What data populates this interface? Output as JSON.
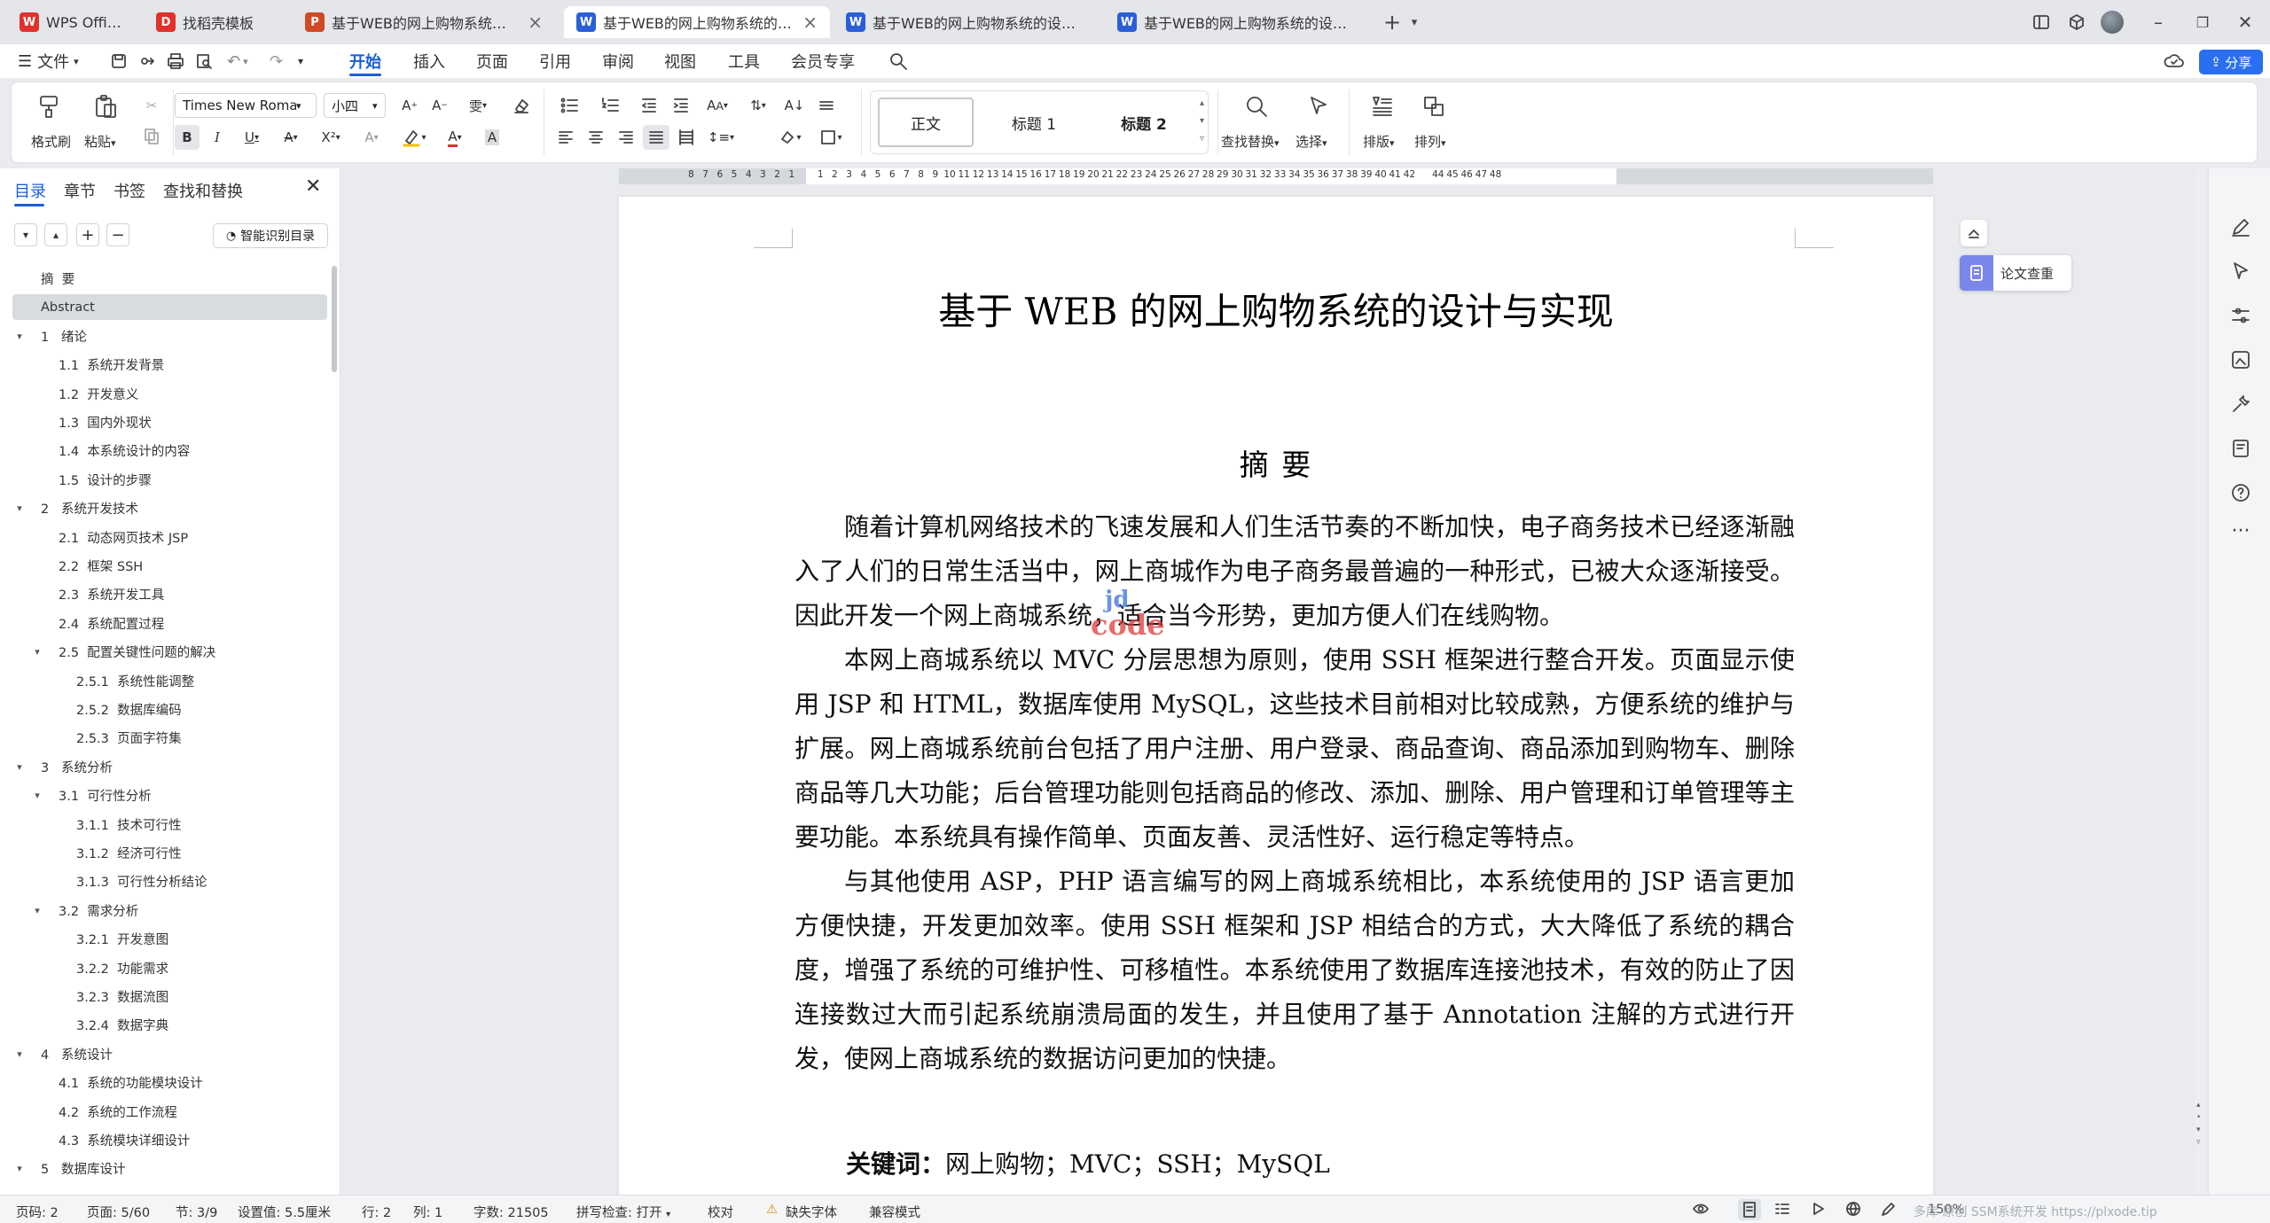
{
  "tabs": [
    {
      "label": "WPS Office",
      "letter": "W",
      "color": "#e0322b"
    },
    {
      "label": "找稻壳模板",
      "letter": "D",
      "color": "#e0322b"
    },
    {
      "label": "基于WEB的网上购物系统的设计与实",
      "letter": "P",
      "color": "#d04a23"
    },
    {
      "label": "基于WEB的网上购物系统的设计与实",
      "letter": "W",
      "color": "#2b5fd8"
    },
    {
      "label": "基于WEB的网上购物系统的设计与实现",
      "letter": "W",
      "color": "#2b5fd8"
    },
    {
      "label": "基于WEB的网上购物系统的设计与实",
      "letter": "W",
      "color": "#2b5fd8"
    }
  ],
  "menu": {
    "file": "文件",
    "items": [
      "开始",
      "插入",
      "页面",
      "引用",
      "审阅",
      "视图",
      "工具",
      "会员专享"
    ],
    "share": "分享"
  },
  "ribbon": {
    "format_painter": "格式刷",
    "paste": "粘贴",
    "font_name": "Times New Roman",
    "font_size": "小四",
    "styles": [
      "正文",
      "标题 1",
      "标题 2"
    ],
    "find_replace": "查找替换",
    "select": "选择",
    "layout": "排版",
    "arrange": "排列"
  },
  "nav": {
    "tabs": [
      "目录",
      "章节",
      "书签",
      "查找和替换"
    ],
    "smart_toc": "智能识别目录",
    "toc": [
      {
        "label": "摘  要",
        "level": 1,
        "toggle": false,
        "sel": false
      },
      {
        "label": "Abstract",
        "level": 1,
        "toggle": false,
        "sel": true
      },
      {
        "label": "1   绪论",
        "level": 1,
        "toggle": true
      },
      {
        "label": "1.1  系统开发背景",
        "level": 2
      },
      {
        "label": "1.2  开发意义",
        "level": 2
      },
      {
        "label": "1.3  国内外现状",
        "level": 2
      },
      {
        "label": "1.4  本系统设计的内容",
        "level": 2
      },
      {
        "label": "1.5  设计的步骤",
        "level": 2
      },
      {
        "label": "2   系统开发技术",
        "level": 1,
        "toggle": true
      },
      {
        "label": "2.1  动态网页技术 JSP",
        "level": 2
      },
      {
        "label": "2.2  框架 SSH",
        "level": 2
      },
      {
        "label": "2.3  系统开发工具",
        "level": 2
      },
      {
        "label": "2.4  系统配置过程",
        "level": 2
      },
      {
        "label": "2.5  配置关键性问题的解决",
        "level": 2,
        "toggle": true
      },
      {
        "label": "2.5.1  系统性能调整",
        "level": 3
      },
      {
        "label": "2.5.2  数据库编码",
        "level": 3
      },
      {
        "label": "2.5.3  页面字符集",
        "level": 3
      },
      {
        "label": "3   系统分析",
        "level": 1,
        "toggle": true
      },
      {
        "label": "3.1  可行性分析",
        "level": 2,
        "toggle": true
      },
      {
        "label": "3.1.1  技术可行性",
        "level": 3
      },
      {
        "label": "3.1.2  经济可行性",
        "level": 3
      },
      {
        "label": "3.1.3  可行性分析结论",
        "level": 3
      },
      {
        "label": "3.2  需求分析",
        "level": 2,
        "toggle": true
      },
      {
        "label": "3.2.1  开发意图",
        "level": 3
      },
      {
        "label": "3.2.2  功能需求",
        "level": 3
      },
      {
        "label": "3.2.3  数据流图",
        "level": 3
      },
      {
        "label": "3.2.4  数据字典",
        "level": 3
      },
      {
        "label": "4   系统设计",
        "level": 1,
        "toggle": true
      },
      {
        "label": "4.1  系统的功能模块设计",
        "level": 2
      },
      {
        "label": "4.2  系统的工作流程",
        "level": 2
      },
      {
        "label": "4.3  系统模块详细设计",
        "level": 2
      },
      {
        "label": "5   数据库设计",
        "level": 1,
        "toggle": true
      }
    ]
  },
  "ruler_left": [
    "8",
    "7",
    "6",
    "5",
    "4",
    "3",
    "2",
    "1"
  ],
  "ruler_right": [
    "1",
    "2",
    "3",
    "4",
    "5",
    "6",
    "7",
    "8",
    "9",
    "10",
    "11",
    "12",
    "13",
    "14",
    "15",
    "16",
    "17",
    "18",
    "19",
    "20",
    "21",
    "22",
    "23",
    "24",
    "25",
    "26",
    "27",
    "28",
    "29",
    "30",
    "31",
    "32",
    "33",
    "34",
    "35",
    "36",
    "37",
    "38",
    "39",
    "40",
    "41",
    "42"
  ],
  "ruler_margin_right": [
    "44",
    "45",
    "46",
    "47",
    "48"
  ],
  "document": {
    "title": "基于 WEB 的网上购物系统的设计与实现",
    "abstract_heading": "摘  要",
    "paragraphs": [
      "随着计算机网络技术的飞速发展和人们生活节奏的不断加快，电子商务技术已经逐渐融入了人们的日常生活当中，网上商城作为电子商务最普遍的一种形式，已被大众逐渐接受。因此开发一个网上商城系统，适合当今形势，更加方便人们在线购物。",
      "本网上商城系统以 MVC 分层思想为原则，使用 SSH 框架进行整合开发。页面显示使用 JSP 和 HTML，数据库使用 MySQL，这些技术目前相对比较成熟，方便系统的维护与扩展。网上商城系统前台包括了用户注册、用户登录、商品查询、商品添加到购物车、删除商品等几大功能；后台管理功能则包括商品的修改、添加、删除、用户管理和订单管理等主要功能。本系统具有操作简单、页面友善、灵活性好、运行稳定等特点。",
      "与其他使用 ASP，PHP 语言编写的网上商城系统相比，本系统使用的 JSP 语言更加方便快捷，开发更加效率。使用 SSH 框架和 JSP 相结合的方式，大大降低了系统的耦合度，增强了系统的可维护性、可移植性。本系统使用了数据库连接池技术，有效的防止了因连接数过大而引起系统崩溃局面的发生，并且使用了基于 Annotation 注解的方式进行开发，使网上商城系统的数据访问更加的快捷。"
    ],
    "keywords_label": "关键词：",
    "keywords": "网上购物；MVC；SSH；MySQL",
    "watermark_top": "jd",
    "watermark_bottom": "code"
  },
  "paper_check": "论文查重",
  "status": {
    "page_code": "页码: 2",
    "page": "页面: 5/60",
    "section": "节: 3/9",
    "setting": "设置值: 5.5厘米",
    "row": "行: 2",
    "col": "列: 1",
    "words": "字数: 21505",
    "spell": "拼写检查: 打开",
    "proof": "校对",
    "missing_font": "缺失字体",
    "compat": "兼容模式",
    "zoom": "150%",
    "overlay_text": "多库 原创 SSM系统开发 https://plxode.tip"
  },
  "colors": {
    "accent": "#1a5fd6",
    "share": "#2a6ff0",
    "watermark_blue": "#3a6fd8",
    "watermark_red": "#e03a3a"
  }
}
